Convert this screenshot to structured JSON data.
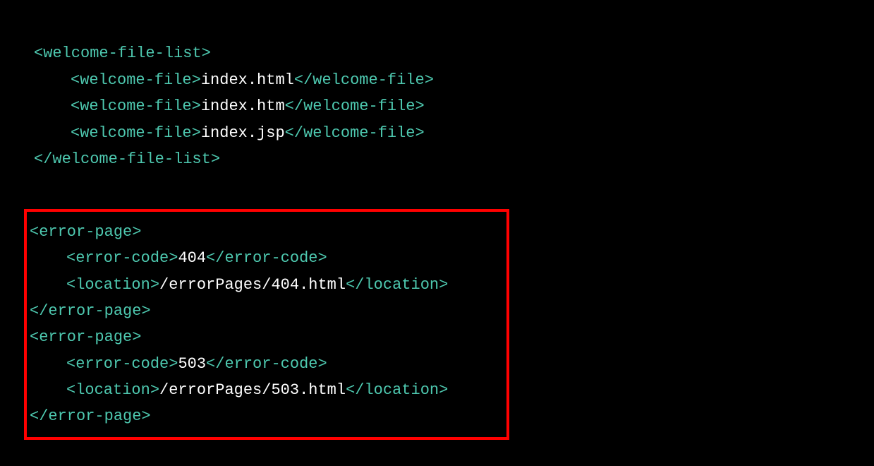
{
  "welcome_block": {
    "open_tag": "<welcome-file-list>",
    "files": [
      {
        "open": "<welcome-file>",
        "value": "index.html",
        "close": "</welcome-file>"
      },
      {
        "open": "<welcome-file>",
        "value": "index.htm",
        "close": "</welcome-file>"
      },
      {
        "open": "<welcome-file>",
        "value": "index.jsp",
        "close": "</welcome-file>"
      }
    ],
    "close_tag": "</welcome-file-list>"
  },
  "error_block": {
    "pages": [
      {
        "open": "<error-page>",
        "code_open": "<error-code>",
        "code_value": "404",
        "code_close": "</error-code>",
        "loc_open": "<location>",
        "loc_value": "/errorPages/404.html",
        "loc_close": "</location>",
        "close": "</error-page>"
      },
      {
        "open": "<error-page>",
        "code_open": "<error-code>",
        "code_value": "503",
        "code_close": "</error-code>",
        "loc_open": "<location>",
        "loc_value": "/errorPages/503.html",
        "loc_close": "</location>",
        "close": "</error-page>"
      }
    ]
  }
}
